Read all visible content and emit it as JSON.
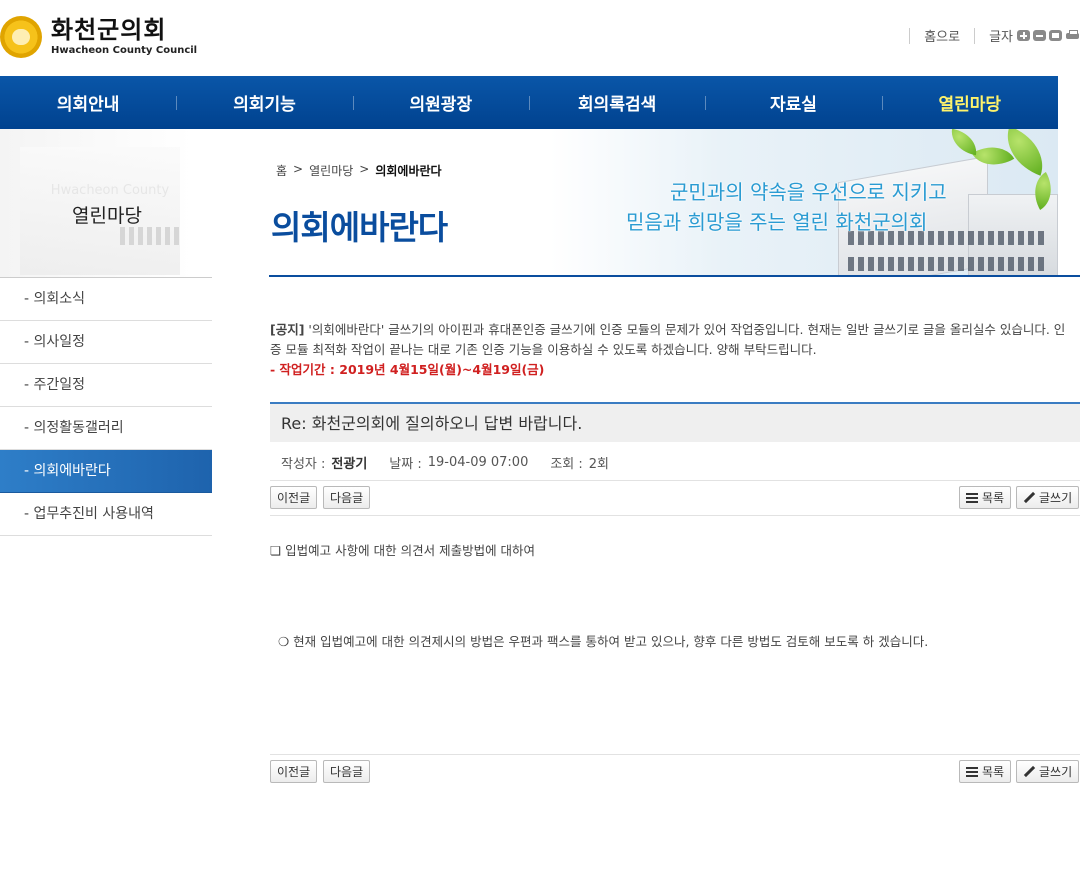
{
  "header": {
    "logo_ko": "화천군의회",
    "logo_en": "Hwacheon County Council",
    "home_label": "홈으로",
    "font_label": "글자"
  },
  "gnb": {
    "items": [
      {
        "label": "의회안내"
      },
      {
        "label": "의회기능"
      },
      {
        "label": "의원광장"
      },
      {
        "label": "회의록검색"
      },
      {
        "label": "자료실"
      },
      {
        "label": "열린마당"
      }
    ],
    "active_index": 5
  },
  "visual": {
    "slogan_line1": "군민과의 약속을 우선으로 지키고",
    "slogan_line2": "믿음과 희망을 주는 열린 화천군의회"
  },
  "lnb": {
    "title_en": "Hwacheon County",
    "title": "열린마당",
    "items": [
      {
        "label": "- 의회소식"
      },
      {
        "label": "- 의사일정"
      },
      {
        "label": "- 주간일정"
      },
      {
        "label": "- 의정활동갤러리"
      },
      {
        "label": "- 의회에바란다"
      },
      {
        "label": "- 업무추진비 사용내역"
      }
    ],
    "active_index": 4
  },
  "breadcrumb": {
    "home": "홈",
    "sep": ">",
    "level1": "열린마당",
    "current": "의회에바란다"
  },
  "page_title": "의회에바란다",
  "notice": {
    "tag": "[공지]",
    "text": " '의회에바란다' 글쓰기의 아이핀과 휴대폰인증 글쓰기에 인증 모듈의 문제가 있어 작업중입니다. 현재는 일반 글쓰기로 글을 올리실수 있습니다. 인증 모듈 최적화 작업이 끝나는 대로 기존 인증 기능을 이용하실 수 있도록 하겠습니다. 양해 부탁드립니다.",
    "period": "- 작업기간 : 2019년 4월15일(월)~4월19일(금)"
  },
  "post": {
    "title": "Re: 화천군의회에 질의하오니 답변 바랍니다.",
    "author_label": "작성자 :",
    "author": "전광기",
    "date_label": "날짜 :",
    "date": "19-04-09 07:00",
    "views_label": "조회 :",
    "views": "2회",
    "line1": "❏ 입법예고 사항에 대한 의견서 제출방법에 대하여",
    "line2": "❍ 현재 입법예고에 대한 의견제시의 방법은 우편과 팩스를  통하여 받고 있으나, 향후 다른 방법도 검토해 보도록 하 겠습니다."
  },
  "buttons": {
    "prev": "이전글",
    "next": "다음글",
    "list": "목록",
    "write": "글쓰기"
  },
  "colors": {
    "brand_blue": "#0a4d9e",
    "gnb_active": "#fff36b",
    "notice_red": "#d02020"
  }
}
